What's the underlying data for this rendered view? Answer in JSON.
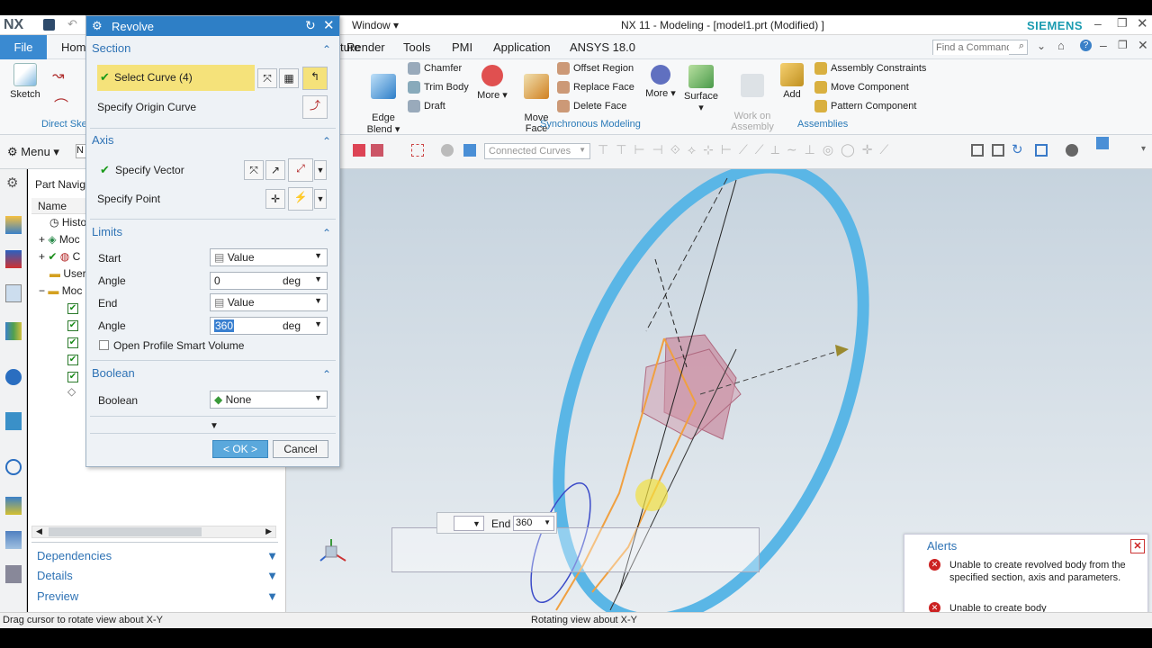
{
  "window": {
    "app_logo": "NX",
    "title": "NX 11 - Modeling - [model1.prt (Modified) ]",
    "window_menu": "Window ▾",
    "brand": "SIEMENS",
    "find_placeholder": "Find a Command"
  },
  "menu": {
    "file": "File",
    "home": "Hom",
    "tabs": [
      "ture",
      "Render",
      "Tools",
      "PMI",
      "Application",
      "ANSYS 18.0"
    ]
  },
  "ribbon": {
    "sketch": "Sketch",
    "direct_sketch": "Direct Ske",
    "edge_blend": "Edge\nBlend ▾",
    "feature_items": [
      "Chamfer",
      "Trim Body",
      "Draft"
    ],
    "more1": "More",
    "move_face": "Move\nFace",
    "sync_items": [
      "Offset Region",
      "Replace Face",
      "Delete Face"
    ],
    "more2": "More",
    "sync_label": "Synchronous Modeling",
    "surface": "Surface",
    "work_on_assembly": "Work on\nAssembly",
    "add": "Add",
    "asm_items": [
      "Assembly Constraints",
      "Move Component",
      "Pattern Component"
    ],
    "asm_label": "Assemblies"
  },
  "toolbar2": {
    "menu": "Menu ▾",
    "filter": "Connected Curves"
  },
  "dialog": {
    "title": "Revolve",
    "section": {
      "header": "Section",
      "select_curve": "Select Curve (4)",
      "origin_curve": "Specify Origin Curve"
    },
    "axis": {
      "header": "Axis",
      "vector": "Specify Vector",
      "point": "Specify Point"
    },
    "limits": {
      "header": "Limits",
      "start_label": "Start",
      "start_value": "Value",
      "angle1_label": "Angle",
      "angle1_value": "0",
      "unit": "deg",
      "end_label": "End",
      "end_value": "Value",
      "angle2_label": "Angle",
      "angle2_value": "360",
      "open_profile": "Open Profile Smart Volume"
    },
    "boolean": {
      "header": "Boolean",
      "label": "Boolean",
      "value": "None"
    },
    "ok": "< OK >",
    "cancel": "Cancel"
  },
  "navigator": {
    "title": "Part Navigat",
    "col_name": "Name",
    "rows": [
      "Histo",
      "Moc",
      "C",
      "User",
      "Moc"
    ],
    "dependencies": "Dependencies",
    "details": "Details",
    "preview": "Preview"
  },
  "viewport": {
    "end_label": "End",
    "end_value": "360"
  },
  "alerts": {
    "title": "Alerts",
    "items": [
      "Unable to create revolved body from the specified section, axis and parameters.",
      "Unable to create body"
    ]
  },
  "status": {
    "left": "Drag cursor to rotate view about X-Y",
    "center": "Rotating view about X-Y"
  },
  "colors": {
    "accent": "#2e7fc6",
    "selection": "#f5e27a",
    "ring": "#58b6e6",
    "error": "#cc2222"
  }
}
